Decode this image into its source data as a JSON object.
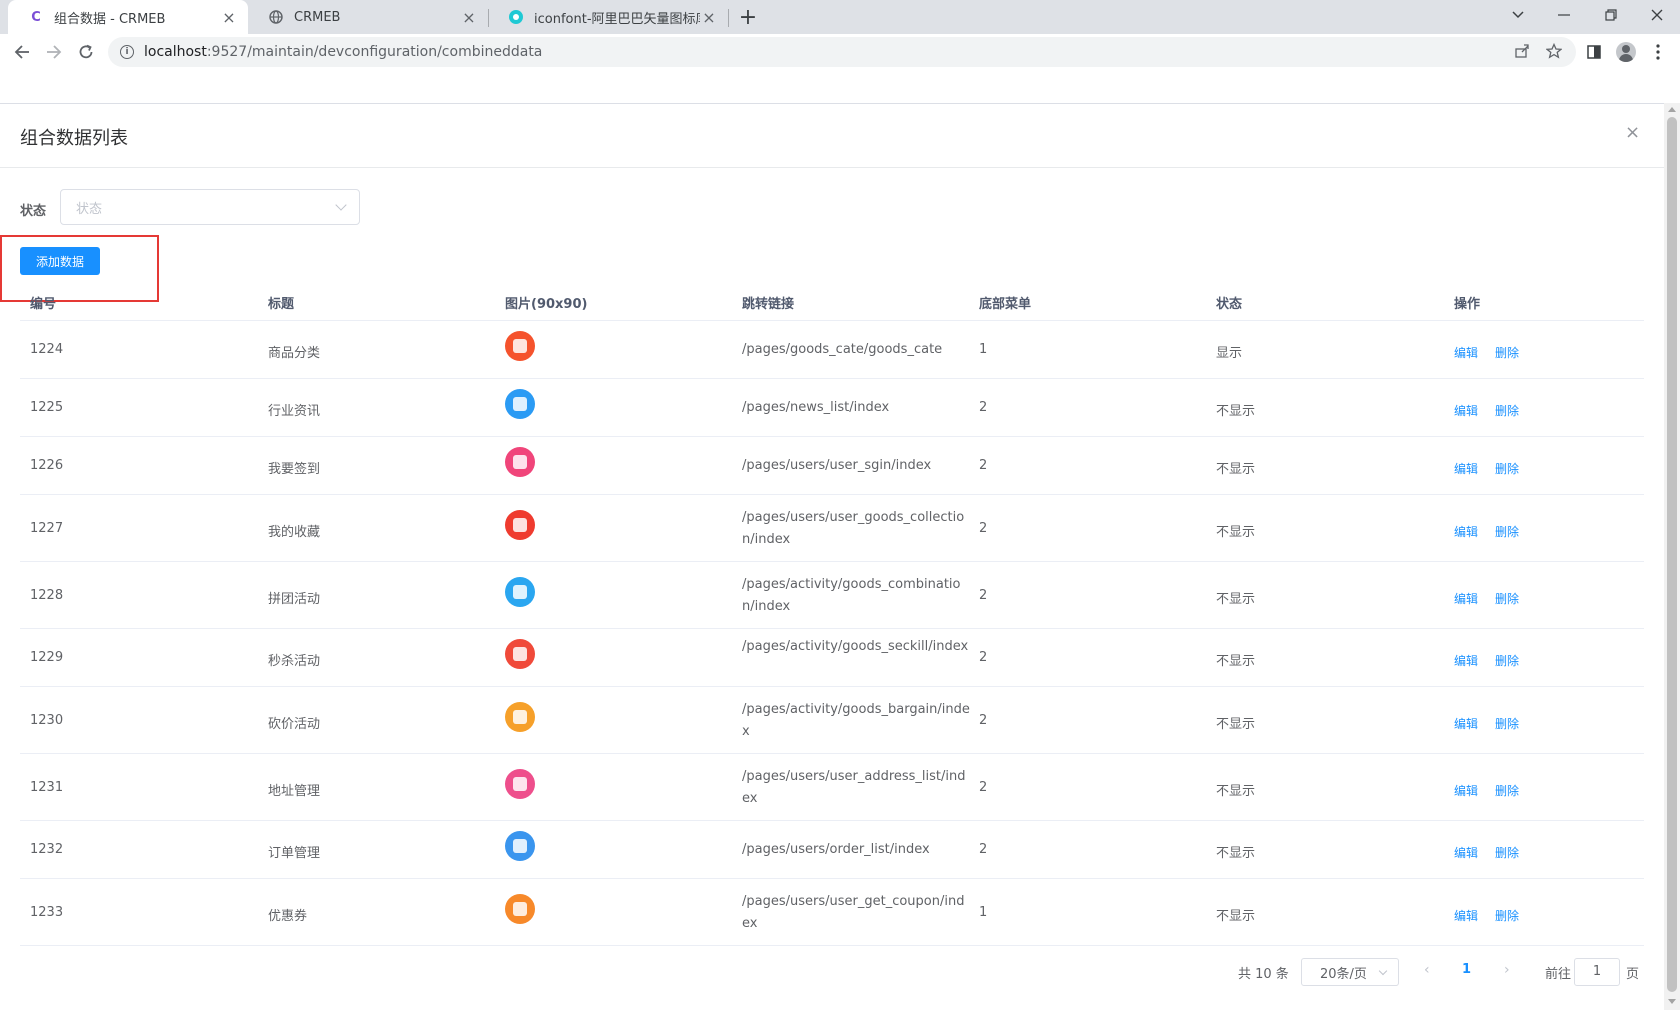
{
  "browser": {
    "tabs": [
      {
        "title": "组合数据 - CRMEB",
        "favicon": "C"
      },
      {
        "title": "CRMEB",
        "favicon": "globe-icon"
      },
      {
        "title": "iconfont-阿里巴巴矢量图标库",
        "favicon": "iconfont-icon"
      }
    ],
    "url_host": "localhost",
    "url_path": ":9527/maintain/devconfiguration/combineddata"
  },
  "dialog": {
    "title": "组合数据列表",
    "close": "×"
  },
  "filter": {
    "label": "状态",
    "placeholder": "状态"
  },
  "add_button": "添加数据",
  "table": {
    "columns": [
      "编号",
      "标题",
      "图片(90x90)",
      "跳转链接",
      "底部菜单",
      "状态",
      "操作"
    ],
    "edit_label": "编辑",
    "delete_label": "删除",
    "rows": [
      {
        "id": "1224",
        "title": "商品分类",
        "link": "/pages/goods_cate/goods_cate",
        "menu": "1",
        "status": "显示",
        "color": "#f5532d"
      },
      {
        "id": "1225",
        "title": "行业资讯",
        "link": "/pages/news_list/index",
        "menu": "2",
        "status": "不显示",
        "color": "#2b9bf4"
      },
      {
        "id": "1226",
        "title": "我要签到",
        "link": "/pages/users/user_sgin/index",
        "menu": "2",
        "status": "不显示",
        "color": "#f0457a"
      },
      {
        "id": "1227",
        "title": "我的收藏",
        "link": "/pages/users/user_goods_collection/index",
        "menu": "2",
        "status": "不显示",
        "color": "#ef3b2f"
      },
      {
        "id": "1228",
        "title": "拼团活动",
        "link": "/pages/activity/goods_combination/index",
        "menu": "2",
        "status": "不显示",
        "color": "#2aa6f0"
      },
      {
        "id": "1229",
        "title": "秒杀活动",
        "link": "/pages/activity/goods_seckill/index",
        "menu": "2",
        "status": "不显示",
        "color": "#f04a3a"
      },
      {
        "id": "1230",
        "title": "砍价活动",
        "link": "/pages/activity/goods_bargain/index",
        "menu": "2",
        "status": "不显示",
        "color": "#f6a02a"
      },
      {
        "id": "1231",
        "title": "地址管理",
        "link": "/pages/users/user_address_list/index",
        "menu": "2",
        "status": "不显示",
        "color": "#ee4f8c"
      },
      {
        "id": "1232",
        "title": "订单管理",
        "link": "/pages/users/order_list/index",
        "menu": "2",
        "status": "不显示",
        "color": "#3a95ee"
      },
      {
        "id": "1233",
        "title": "优惠券",
        "link": "/pages/users/user_get_coupon/index",
        "menu": "1",
        "status": "不显示",
        "color": "#f7892a"
      }
    ]
  },
  "pagination": {
    "total": "共 10 条",
    "page_size": "20条/页",
    "current": "1",
    "goto_label": "前往",
    "goto_value": "1",
    "page_suffix": "页"
  }
}
